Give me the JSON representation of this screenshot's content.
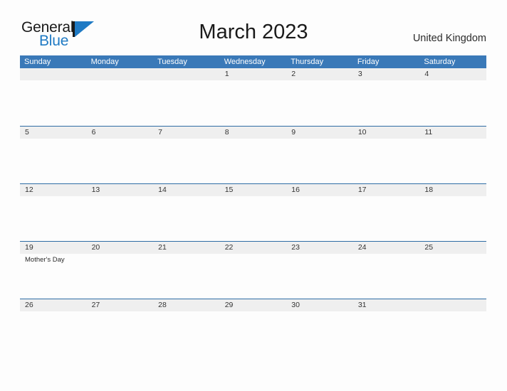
{
  "brand": {
    "name_part1": "General",
    "name_part2": "Blue",
    "accent_color": "#1f7ac4"
  },
  "header": {
    "title": "March 2023",
    "region": "United Kingdom"
  },
  "calendar": {
    "header_color": "#3a79b8",
    "band_color": "#efefef",
    "rule_color": "#2e6ca4",
    "weekday_headers": [
      "Sunday",
      "Monday",
      "Tuesday",
      "Wednesday",
      "Thursday",
      "Friday",
      "Saturday"
    ],
    "weeks": [
      {
        "days": [
          {
            "number": "",
            "events": []
          },
          {
            "number": "",
            "events": []
          },
          {
            "number": "",
            "events": []
          },
          {
            "number": "1",
            "events": []
          },
          {
            "number": "2",
            "events": []
          },
          {
            "number": "3",
            "events": []
          },
          {
            "number": "4",
            "events": []
          }
        ]
      },
      {
        "days": [
          {
            "number": "5",
            "events": []
          },
          {
            "number": "6",
            "events": []
          },
          {
            "number": "7",
            "events": []
          },
          {
            "number": "8",
            "events": []
          },
          {
            "number": "9",
            "events": []
          },
          {
            "number": "10",
            "events": []
          },
          {
            "number": "11",
            "events": []
          }
        ]
      },
      {
        "days": [
          {
            "number": "12",
            "events": []
          },
          {
            "number": "13",
            "events": []
          },
          {
            "number": "14",
            "events": []
          },
          {
            "number": "15",
            "events": []
          },
          {
            "number": "16",
            "events": []
          },
          {
            "number": "17",
            "events": []
          },
          {
            "number": "18",
            "events": []
          }
        ]
      },
      {
        "days": [
          {
            "number": "19",
            "events": [
              "Mother's Day"
            ]
          },
          {
            "number": "20",
            "events": []
          },
          {
            "number": "21",
            "events": []
          },
          {
            "number": "22",
            "events": []
          },
          {
            "number": "23",
            "events": []
          },
          {
            "number": "24",
            "events": []
          },
          {
            "number": "25",
            "events": []
          }
        ]
      },
      {
        "days": [
          {
            "number": "26",
            "events": []
          },
          {
            "number": "27",
            "events": []
          },
          {
            "number": "28",
            "events": []
          },
          {
            "number": "29",
            "events": []
          },
          {
            "number": "30",
            "events": []
          },
          {
            "number": "31",
            "events": []
          },
          {
            "number": "",
            "events": []
          }
        ]
      }
    ]
  }
}
